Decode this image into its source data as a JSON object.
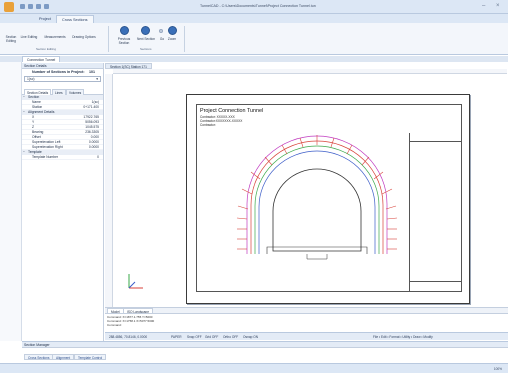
{
  "window": {
    "title": "TunnelCAD - C:\\Users\\Documents\\Tunnel\\Project Connection Tunnel.tun"
  },
  "tabs": [
    {
      "label": "Project"
    },
    {
      "label": "Cross Sections"
    }
  ],
  "ribbon": {
    "buttons": [
      {
        "label": "Section Editing"
      },
      {
        "label": "Line Editing"
      },
      {
        "label": "Measurements"
      },
      {
        "label": "Drawing Options"
      },
      {
        "label": "Previous Section"
      },
      {
        "label": "Next Section"
      },
      {
        "label": "Go"
      },
      {
        "label": "Zoom"
      }
    ],
    "groups": [
      {
        "label": "Section Editing"
      },
      {
        "label": "Sections"
      }
    ]
  },
  "doc_tab": {
    "label": "Connection Tunnel"
  },
  "left_panel": {
    "header": "Section Details",
    "count_label": "Number of Sections in Project:",
    "count_value": "101",
    "select_value": "1(sc)",
    "sub_tabs": [
      {
        "label": "Section Details"
      },
      {
        "label": "Lines"
      },
      {
        "label": "Volumes"
      }
    ],
    "groups": [
      {
        "name": "Section",
        "rows": [
          {
            "k": "Name",
            "v": "1(sc)"
          },
          {
            "k": "Station",
            "v": "0+171.400"
          }
        ]
      },
      {
        "name": "Alignment Details",
        "rows": [
          {
            "k": "X",
            "v": "17922.765"
          },
          {
            "k": "Y",
            "v": "5056.093"
          },
          {
            "k": "Z",
            "v": "1045.575"
          },
          {
            "k": "Bearing",
            "v": "236.3305"
          },
          {
            "k": "Offset",
            "v": "0.000"
          },
          {
            "k": "Superelevation Left",
            "v": "0.0000"
          },
          {
            "k": "Superelevation Right",
            "v": "0.0000"
          }
        ]
      },
      {
        "name": "Template",
        "rows": [
          {
            "k": "Template Number",
            "v": "0"
          }
        ]
      }
    ]
  },
  "main": {
    "drawing_tab": "Section 1(SC) Station 171",
    "paper": {
      "title": "Project Connection Tunnel",
      "lines": [
        "Contractor: XXXXX-XXX",
        "Contractor:XXXXXXX-XXXXX",
        "Contractor:"
      ]
    },
    "model_tabs": [
      {
        "label": "Model"
      },
      {
        "label": "ISO Landscape"
      }
    ]
  },
  "command": {
    "lines": [
      "Command:  X=1877.1.755 Y=5000",
      "Command:  X=1758.1 X=5077.5000"
    ],
    "label": "Command:"
  },
  "status_bar": {
    "coords": "288.4856,  70.8146,  0.0000",
    "toggles": [
      "PAPER",
      "Snap OFF",
      "Grid OFF",
      "Ortho OFF",
      "Osnap ON"
    ],
    "menus": "File  •  Edit  •  Format  •  Utility  •  Draw  •  Modify"
  },
  "bottom_panel": {
    "header": "Section Manager",
    "tabs": [
      {
        "label": "Cross Sections"
      },
      {
        "label": "Alignment"
      },
      {
        "label": "Template Control"
      }
    ]
  },
  "footer": {
    "zoom": "100%"
  },
  "colors": {
    "accent": "#3a6fb8",
    "ribbon_bg": "#f3f6fb",
    "title_bg": "#dce7f5",
    "tunnel_red": "#d8423a",
    "tunnel_green": "#3aa84a",
    "tunnel_blue": "#3b5cc8",
    "tunnel_magenta": "#c03ac0"
  }
}
